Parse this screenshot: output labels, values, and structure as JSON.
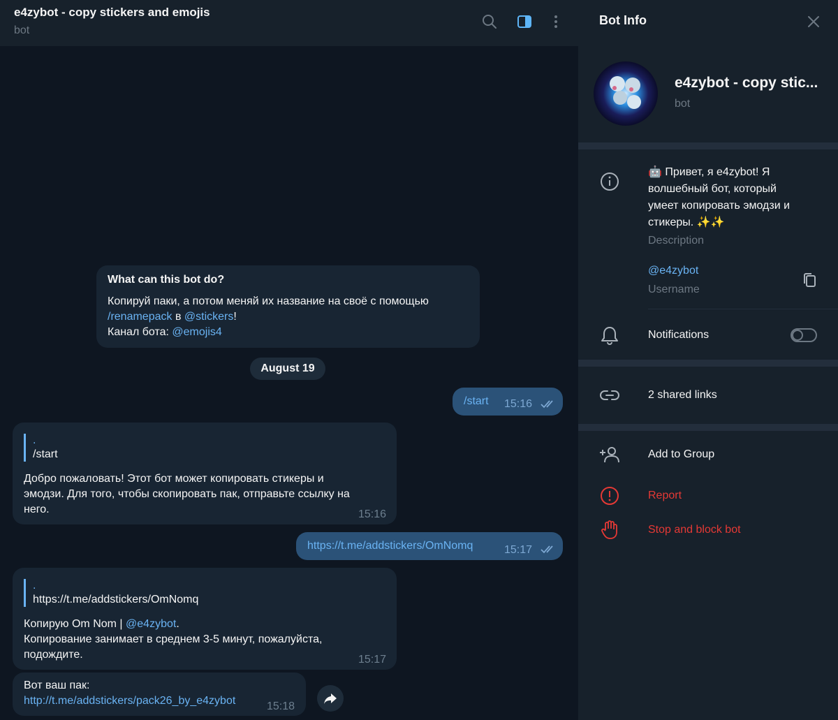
{
  "chat": {
    "title": "e4zybot - copy stickers and emojis",
    "status": "bot",
    "intro": {
      "heading": "What can this bot do?",
      "line1": "Копируй паки, а потом меняй их название на своё с помощью",
      "cmd": "/renamepack",
      "word_in": " в ",
      "mention": "@stickers",
      "excl": "!",
      "channel_label": "Канал бота: ",
      "channel": "@emojis4"
    },
    "date": "August 19",
    "messages": [
      {
        "text": "/start",
        "time": "15:16",
        "read": true
      },
      {
        "reply_dot": ".",
        "reply_text": "/start",
        "text_l1": "Добро пожаловать! Этот бот может копировать стикеры и",
        "text_l2": "эмодзи. Для того, чтобы скопировать пак, отправьте ссылку на",
        "text_l3": "него.",
        "time": "15:16"
      },
      {
        "text": "https://t.me/addstickers/OmNomq",
        "time": "15:17",
        "read": true
      },
      {
        "reply_dot": ".",
        "reply_text": "https://t.me/addstickers/OmNomq",
        "text_l1a": "Копирую Om Nom | ",
        "text_l1_mention": "@e4zybot",
        "text_l1b": ".",
        "text_l2": "Копирование занимает в среднем 3-5 минут, пожалуйста,",
        "text_l3": "подождите.",
        "time": "15:17"
      },
      {
        "text_l1": "Вот ваш пак:",
        "link": "http://t.me/addstickers/pack26_by_e4zybot",
        "time": "15:18"
      }
    ]
  },
  "panel": {
    "title": "Bot Info",
    "bot_name": "e4zybot - copy stic...",
    "bot_kind": "bot",
    "description_l1": "🤖 Привет, я e4zybot! Я",
    "description_l2": "волшебный бот, который",
    "description_l3": "умеет копировать эмодзи и",
    "description_l4": "стикеры. ✨✨",
    "description_label": "Description",
    "username": "@e4zybot",
    "username_label": "Username",
    "notifications_label": "Notifications",
    "notifications_on": false,
    "shared_links": "2 shared links",
    "add_to_group": "Add to Group",
    "report": "Report",
    "stop_block": "Stop and block bot"
  },
  "colors": {
    "accent": "#6ab3f3",
    "danger": "#e53935",
    "outgoing_bubble": "#2b5278",
    "incoming_bubble": "#182533"
  }
}
